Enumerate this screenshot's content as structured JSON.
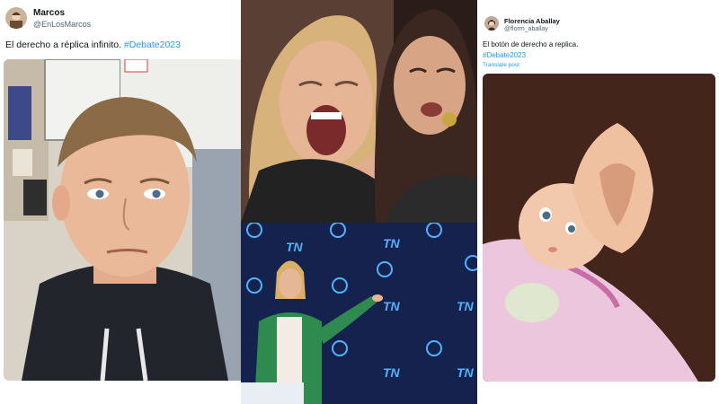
{
  "left_tweet": {
    "display_name": "Marcos",
    "handle": "@EnLosMarcos",
    "text": "El derecho a réplica infinito.",
    "hashtag": "#Debate2023",
    "image_icon": "hesitant-young-man-photo"
  },
  "middle_panel": {
    "top_image_icon": "woman-yelling-meme-photo",
    "bottom_image_icon": "debate-stage-pointing-photo",
    "logo_text": "TN"
  },
  "right_tweet": {
    "display_name": "Florencia Aballay",
    "handle": "@florm_aballay",
    "text": "El botón de derecho a replica.",
    "hashtag": "#Debate2023",
    "translate_label": "Translate post",
    "image_icon": "baby-doll-dented-head-photo"
  },
  "colors": {
    "hashtag": "#1d9bf0",
    "secondary_text": "#536471",
    "primary_text": "#0f1419",
    "tn_background": "#15224d",
    "tn_accent": "#4fb3ff"
  }
}
